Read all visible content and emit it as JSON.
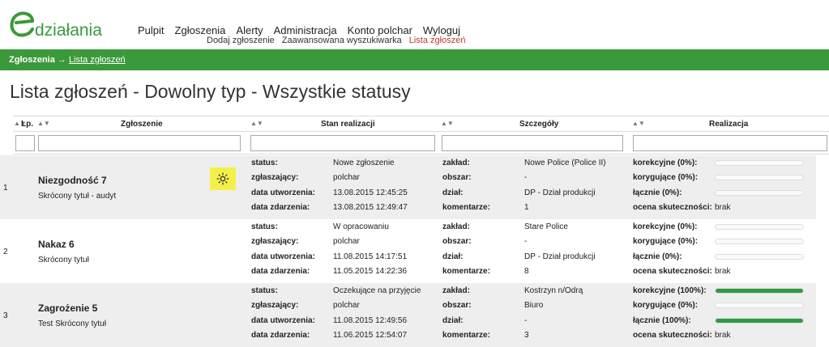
{
  "brand": {
    "logo_letter": "e",
    "logo_text": "działania",
    "color": "#3a9a3a"
  },
  "nav": {
    "main": [
      "Pulpit",
      "Zgłoszenia",
      "Alerty",
      "Administracja",
      "Konto polchar",
      "Wyloguj"
    ],
    "sub": [
      {
        "label": "Dodaj zgłoszenie",
        "active": false
      },
      {
        "label": "Zaawansowana wyszukiwarka",
        "active": false
      },
      {
        "label": "Lista zgłoszeń",
        "active": true
      }
    ]
  },
  "breadcrumb": {
    "root": "Zgłoszenia",
    "arrow": "→",
    "current": "Lista zgłoszeń"
  },
  "page_title": "Lista zgłoszeń - Dowolny typ - Wszystkie statusy",
  "columns": {
    "lp": "Lp.",
    "zgloszenie": "Zgłoszenie",
    "stan": "Stan realizacji",
    "szczegoly": "Szczegóły",
    "realizacja": "Realizacja"
  },
  "icons": {
    "sort": "sort-icon",
    "gear": "gear-icon"
  },
  "labels": {
    "status": "status:",
    "zglaszajacy": "zgłaszający:",
    "data_utworzenia": "data utworzenia:",
    "data_zdarzenia": "data zdarzenia:",
    "zaklad": "zakład:",
    "obszar": "obszar:",
    "dzial": "dział:",
    "komentarze": "komentarze:",
    "ocena": "ocena skuteczności:"
  },
  "rows": [
    {
      "lp": "1",
      "title": "Niezgodność 7",
      "subtitle": "Skrócony tytuł - audyt",
      "status": "Nowe zgłoszenie",
      "zglaszajacy": "polchar",
      "data_utworzenia": "13.08.2015 12:45:25",
      "data_zdarzenia": "13.08.2015 12:49:47",
      "zaklad": "Nowe Police (Police II)",
      "obszar": "-",
      "dzial": "DP - Dział produkcji",
      "komentarze": "1",
      "korekcyjne": "korekcyjne (0%):",
      "korygujace": "korygujące (0%):",
      "lacznie": "łącznie (0%):",
      "korekcyjne_pct": 0,
      "korygujace_pct": 0,
      "lacznie_pct": 0,
      "ocena": "brak"
    },
    {
      "lp": "2",
      "title": "Nakaz 6",
      "subtitle": "Skrócony tytuł",
      "status": "W opracowaniu",
      "zglaszajacy": "polchar",
      "data_utworzenia": "11.08.2015 14:17:51",
      "data_zdarzenia": "11.05.2015 14:22:36",
      "zaklad": "Stare Police",
      "obszar": "-",
      "dzial": "DP - Dział produkcji",
      "komentarze": "8",
      "korekcyjne": "korekcyjne (0%):",
      "korygujace": "korygujące (0%):",
      "lacznie": "łącznie (0%):",
      "korekcyjne_pct": 0,
      "korygujace_pct": 0,
      "lacznie_pct": 0,
      "ocena": "brak"
    },
    {
      "lp": "3",
      "title": "Zagrożenie 5",
      "subtitle": "Test Skrócony tytuł",
      "status": "Oczekujące na przyjęcie",
      "zglaszajacy": "polchar",
      "data_utworzenia": "11.08.2015 12:49:56",
      "data_zdarzenia": "11.06.2015 12:54:07",
      "zaklad": "Kostrzyn n/Odrą",
      "obszar": "Biuro",
      "dzial": "-",
      "komentarze": "3",
      "korekcyjne": "korekcyjne (100%):",
      "korygujace": "korygujące (0%):",
      "lacznie": "łącznie (100%):",
      "korekcyjne_pct": 100,
      "korygujace_pct": 0,
      "lacznie_pct": 100,
      "ocena": "brak"
    }
  ]
}
